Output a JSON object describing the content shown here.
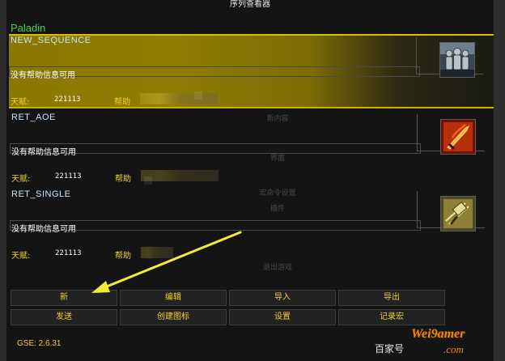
{
  "window": {
    "title": "序列查看器"
  },
  "class_name": "Paladin",
  "sequences": [
    {
      "name": "NEW_SEQUENCE",
      "help": "没有帮助信息可用",
      "talent_label": "天赋:",
      "talent_value": "221113",
      "help_label": "帮助",
      "icon": "paladin-group-icon",
      "selected": true
    },
    {
      "name": "RET_AOE",
      "help": "没有帮助信息可用",
      "talent_label": "天赋:",
      "talent_value": "221113",
      "help_label": "帮助",
      "icon": "flaming-sword-icon",
      "selected": false
    },
    {
      "name": "RET_SINGLE",
      "help": "没有帮助信息可用",
      "talent_label": "天赋:",
      "talent_value": "221113",
      "help_label": "帮助",
      "icon": "hammer-strike-icon",
      "selected": false
    }
  ],
  "background_menu": [
    "新内容",
    "界面",
    "宏命令设置",
    "插件",
    "退出游戏"
  ],
  "buttons": {
    "new": "新",
    "edit": "编辑",
    "import": "导入",
    "export": "导出",
    "send": "发送",
    "create_icon": "创建图标",
    "settings": "设置",
    "record_macro": "记录宏"
  },
  "version": "GSE: 2.6.31",
  "watermark": {
    "text": "百家号",
    "logo": "Wei9amer",
    "logo2": ".com"
  },
  "colors": {
    "accent_yellow": "#f3cf2a",
    "class_green": "#47d44a",
    "selection_gold": "#d6c100",
    "annotation_arrow": "#f0ec3a"
  }
}
